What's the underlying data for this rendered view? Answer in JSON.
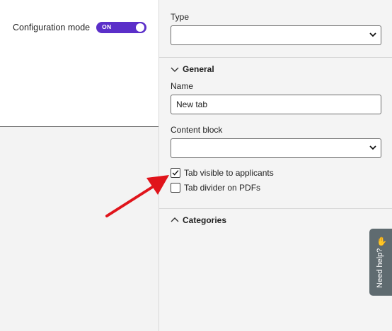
{
  "config": {
    "label": "Configuration mode",
    "toggle_text": "ON"
  },
  "panel": {
    "type_label": "Type",
    "type_value": "",
    "general_label": "General",
    "name_label": "Name",
    "name_value": "New tab",
    "content_block_label": "Content block",
    "content_block_value": "",
    "tab_visible_label": "Tab visible to applicants",
    "tab_visible_checked": true,
    "tab_divider_label": "Tab divider on PDFs",
    "tab_divider_checked": false,
    "categories_label": "Categories"
  },
  "help": {
    "label": "Need help?",
    "icon": "waving-hand-icon"
  },
  "colors": {
    "toggle": "#5b2fc9",
    "annotation_arrow": "#e0141b",
    "help_tab": "#5f6b70"
  }
}
